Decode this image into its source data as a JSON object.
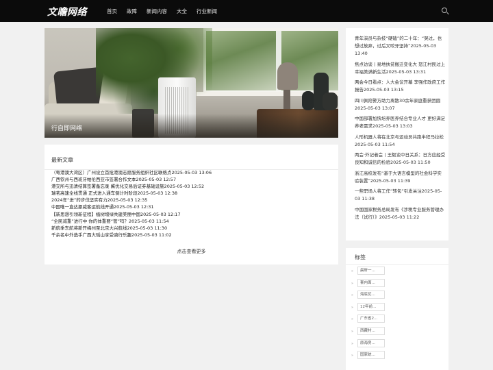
{
  "header": {
    "logo": "文瞻网络",
    "nav": [
      "首页",
      "故障",
      "新闻内容",
      "大全",
      "行业新闻"
    ]
  },
  "hero": {
    "caption": "行自即网络"
  },
  "latest": {
    "title": "最新文章",
    "items": [
      "（粤港澳大湾区）广州设立首批港澳志愿服务组织社区联络点2025-05-03 13:06",
      "广西钦州与西班牙帕伦西亚市签署合作文本2025-05-03 12:57",
      "港交所与迅清结算签署备忘录 冀优化交易后证券基础设施2025-05-03 12:52",
      "瑞茗高速全线贯通 正式进入通车倒计时阶段2025-05-03 12:38",
      "2024年“进”的步伐坚实有力2025-05-03 12:35",
      "中国唯一直达挪威客运航线开通2025-05-03 12:31",
      "【新思想引领新征程】植树增绿共建美丽中国2025-05-03 12:17",
      "“全民减重”进行中 你的体重要“管”吗？2025-05-03 11:54",
      "新航季东航将新开梅州至北京大兴航线2025-05-03 11:30",
      "千余名中外选手广西大瑶山享受骑行乐趣2025-05-03 11:02"
    ],
    "more": "点击查看更多"
  },
  "sidebar": {
    "items": [
      "青年演员与杂技“硬磕”的二十年：“哭过，也想过放弃，过后又咬牙坚持”2025-05-03 13:40",
      "焦点访谈丨易地扶贫搬迁变化大 怒江村民过上幸福美满新生活2025-05-03 13:31",
      "两会今日看点：人大会议开幕 李强作政府工作报告2025-05-03 13:15",
      "四川佩陪警方助力离散30余年家庭重获团圆2025-05-03 13:07",
      "中国部署加快培养医养结合专业人才 更好满足养老需求2025-05-03 13:03",
      "人形机器人将在北京与运动员共跑半程马拉松2025-05-03 11:54",
      "两会·外记者会丨王毅谈中日关系：日方应经受良知和诚信的检验2025-05-03 11:50",
      "浙江高校发布“基于大语言模型的社会科学实验装置”2025-05-03 11:39",
      "一些职场人将工作“转包”引发关注2025-05-03 11:38",
      "中国国家税务总局发布《涉税专业服务管理办法（试行）》2025-05-03 11:22"
    ]
  },
  "tags": {
    "title": "标签",
    "bullet": "»",
    "items": [
      "晨昕一…",
      "套内面…",
      "海底优…",
      "12年前…",
      "广东省2…",
      "西藏村…",
      "原海房…",
      "国家统…"
    ]
  }
}
